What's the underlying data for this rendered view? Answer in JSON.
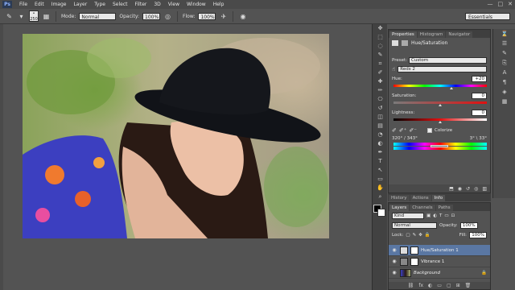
{
  "menubar": {
    "logo": "Ps",
    "items": [
      "File",
      "Edit",
      "Image",
      "Layer",
      "Type",
      "Select",
      "Filter",
      "3D",
      "View",
      "Window",
      "Help"
    ],
    "window_controls": [
      "—",
      "□",
      "✕"
    ]
  },
  "options_bar": {
    "brush_size": "250",
    "mode_label": "Mode:",
    "mode_value": "Normal",
    "opacity_label": "Opacity:",
    "opacity_value": "100%",
    "flow_label": "Flow:",
    "flow_value": "100%",
    "workspace": "Essentials"
  },
  "tools": [
    "move-icon",
    "marquee-icon",
    "lasso-icon",
    "quick-select-icon",
    "crop-icon",
    "eyedropper-icon",
    "healing-icon",
    "brush-icon",
    "clone-stamp-icon",
    "history-brush-icon",
    "eraser-icon",
    "gradient-icon",
    "blur-icon",
    "dodge-icon",
    "pen-icon",
    "type-icon",
    "path-select-icon",
    "shape-icon",
    "hand-icon",
    "zoom-icon"
  ],
  "tool_glyphs": [
    "✥",
    "⬚",
    "◌",
    "✎",
    "⌗",
    "✐",
    "✚",
    "✏",
    "⎔",
    "↺",
    "◫",
    "▤",
    "◔",
    "◐",
    "✒",
    "T",
    "↖",
    "▭",
    "✋",
    "⌕"
  ],
  "properties": {
    "tabs": [
      "Properties",
      "Histogram",
      "Navigator"
    ],
    "title": "Hue/Saturation",
    "preset_label": "Preset:",
    "preset_value": "Custom",
    "channel_value": "Reds 2",
    "hue_label": "Hue:",
    "hue_value": "+20",
    "saturation_label": "Saturation:",
    "saturation_value": "0",
    "lightness_label": "Lightness:",
    "lightness_value": "0",
    "colorize_label": "Colorize",
    "range_left": "320° / 343°",
    "range_right": "3° \\ 33°"
  },
  "history_tabs": [
    "History",
    "Actions",
    "Info"
  ],
  "layers": {
    "tabs": [
      "Layers",
      "Channels",
      "Paths"
    ],
    "kind_value": "Kind",
    "blend_value": "Normal",
    "opacity_label": "Opacity:",
    "opacity_value": "100%",
    "lock_label": "Lock:",
    "fill_label": "Fill:",
    "fill_value": "100%",
    "rows": [
      {
        "name": "Hue/Saturation 1",
        "selected": true
      },
      {
        "name": "Vibrance 1",
        "selected": false
      },
      {
        "name": "Background",
        "selected": false
      }
    ],
    "footer_icons": [
      "fx",
      "◐",
      "▭",
      "▢",
      "⊞",
      "🗑"
    ]
  },
  "colors": {
    "ui_dark": "#535353",
    "selected_layer": "#5a77a3",
    "hat": "#111318"
  }
}
